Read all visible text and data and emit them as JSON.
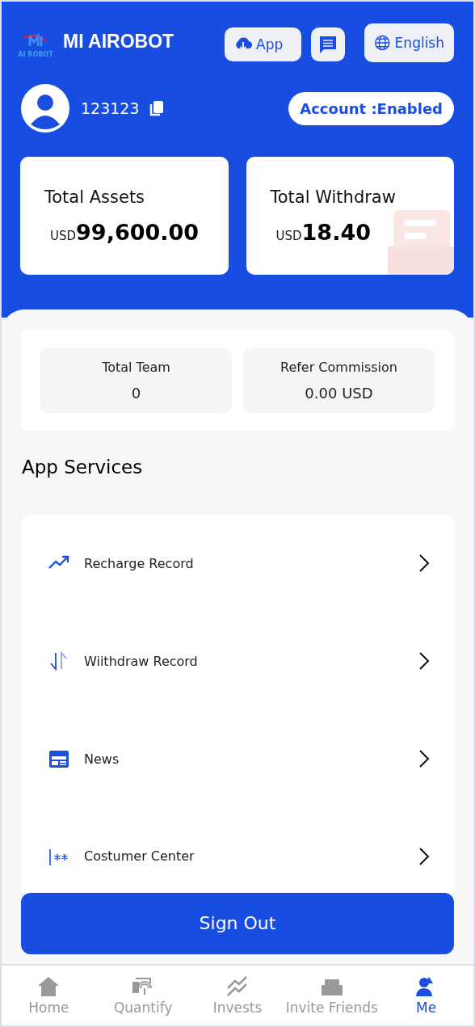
{
  "header": {
    "brand": "MI AIROBOT",
    "logo_text": "AI ROBOT",
    "app_button": "App",
    "language_button": "English"
  },
  "user": {
    "id": "123123",
    "status": "Account :Enabled"
  },
  "balances": [
    {
      "label": "Total Assets",
      "currency": "USD",
      "amount": "99,600.00"
    },
    {
      "label": "Total Withdraw",
      "currency": "USD",
      "amount": "18.40"
    }
  ],
  "team_stats": [
    {
      "label": "Total Team",
      "value": "0"
    },
    {
      "label": "Refer Commission",
      "value": "0.00 USD"
    }
  ],
  "services": {
    "title": "App Services",
    "items": [
      {
        "kind": "trend",
        "label": "Recharge Record"
      },
      {
        "kind": "swap",
        "label": "Wiithdraw Record"
      },
      {
        "kind": "news",
        "label": "News"
      },
      {
        "kind": "service",
        "label": "Costumer Center"
      }
    ]
  },
  "sign_out": "Sign Out",
  "tabs": [
    {
      "kind": "home",
      "label": "Home",
      "selected": false
    },
    {
      "kind": "quantify",
      "label": "Quantify",
      "selected": false
    },
    {
      "kind": "invests",
      "label": "Invests",
      "selected": false
    },
    {
      "kind": "invite",
      "label": "Invite Friends",
      "selected": false
    },
    {
      "kind": "me",
      "label": "Me",
      "selected": true
    }
  ]
}
